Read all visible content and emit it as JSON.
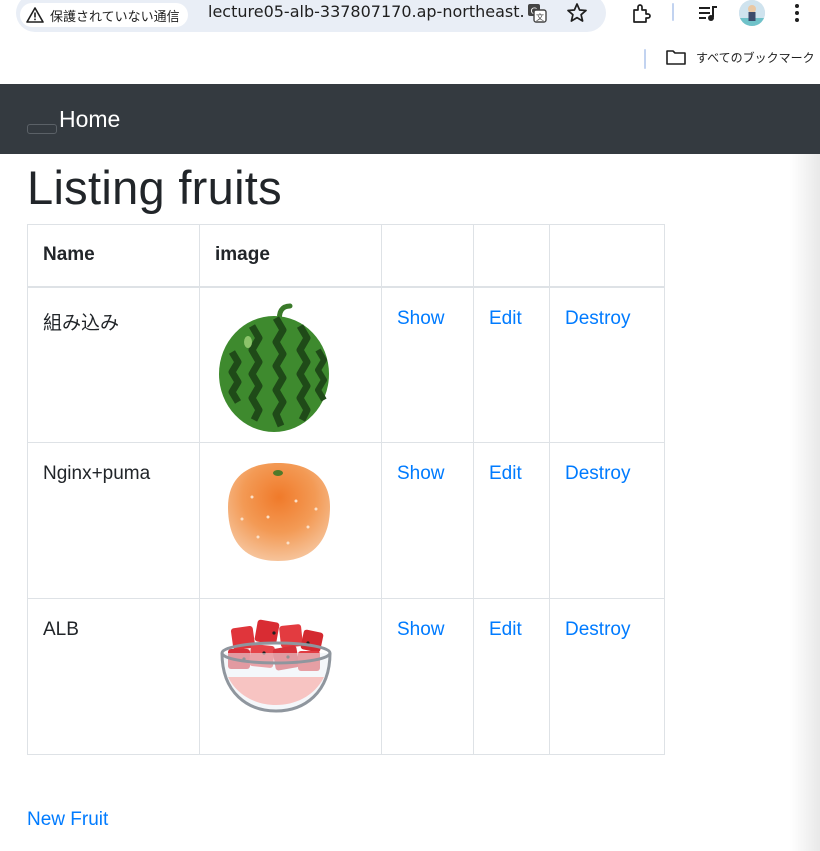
{
  "browser": {
    "security_label": "保護されていない通信",
    "url": "lecture05-alb-337807170.ap-northeast...",
    "bookmarks_label": "すべてのブックマーク"
  },
  "navbar": {
    "brand": "Home"
  },
  "page": {
    "title": "Listing fruits",
    "new_link": "New Fruit"
  },
  "table": {
    "headers": [
      "Name",
      "image",
      "",
      "",
      ""
    ],
    "rows": [
      {
        "name": "組み込み",
        "image_icon": "watermelon-image",
        "show": "Show",
        "edit": "Edit",
        "destroy": "Destroy"
      },
      {
        "name": "Nginx+puma",
        "image_icon": "orange-image",
        "show": "Show",
        "edit": "Edit",
        "destroy": "Destroy"
      },
      {
        "name": "ALB",
        "image_icon": "watermelon-bowl-image",
        "show": "Show",
        "edit": "Edit",
        "destroy": "Destroy"
      }
    ]
  },
  "colors": {
    "navbar_bg": "#343a40",
    "link": "#007bff",
    "text": "#212529"
  }
}
